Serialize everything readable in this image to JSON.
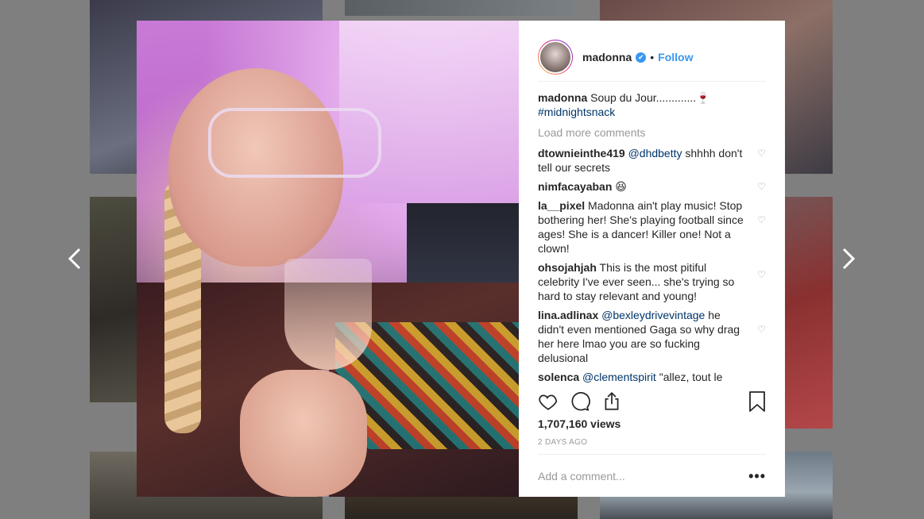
{
  "post": {
    "username": "madonna",
    "verified_mark": "✔",
    "separator": "•",
    "follow_label": "Follow",
    "caption": {
      "username": "madonna",
      "text": " Soup du Jour.............🍷",
      "hashtag": "#midnightsnack"
    },
    "load_more_label": "Load more comments",
    "comments": [
      {
        "user": "dtownieinthe419",
        "mention": "@dhdbetty",
        "text": " shhhh don't tell our secrets"
      },
      {
        "user": "nimfacayaban",
        "mention": "",
        "text": " 😆"
      },
      {
        "user": "la__pixel",
        "mention": "",
        "text": " Madonna ain't play music! Stop bothering her! She's playing football since ages! She is a dancer! Killer one! Not a clown!"
      },
      {
        "user": "ohsojahjah",
        "mention": "",
        "text": " This is the most pitiful celebrity I've ever seen... she's trying so hard to stay relevant and young!"
      },
      {
        "user": "lina.adlinax",
        "mention": "@bexleydrivevintage",
        "text": " he didn't even mentioned Gaga so why drag her here lmao you are so fucking delusional"
      },
      {
        "user": "solenca",
        "mention": "@clementspirit",
        "text": " \"allez, tout le"
      }
    ],
    "views": "1,707,160 views",
    "time_ago": "2 DAYS AGO",
    "add_comment_placeholder": "Add a comment...",
    "more_label": "•••"
  },
  "navigation": {
    "prev_icon": "chevron-left",
    "next_icon": "chevron-right"
  },
  "colors": {
    "accent": "#3897f0",
    "mention": "#003569",
    "muted": "#999999",
    "text": "#262626"
  }
}
